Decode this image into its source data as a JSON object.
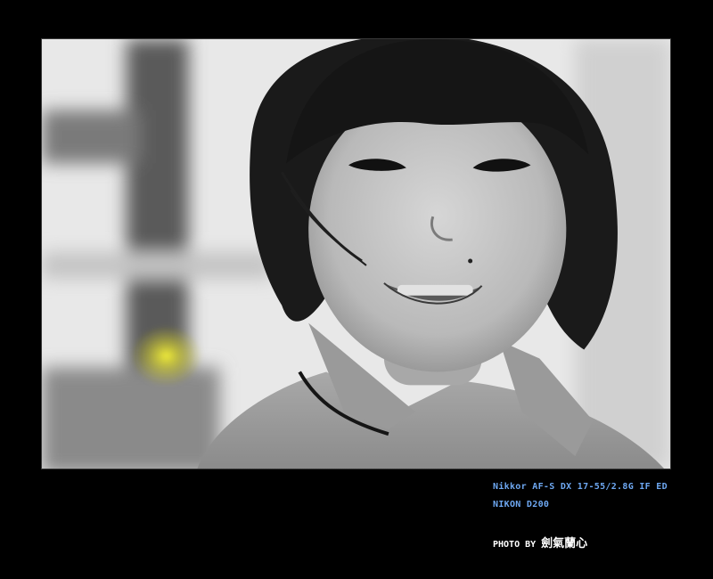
{
  "photo": {
    "subject": "smiling-girl-portrait",
    "colors": {
      "frame_background": "#000000",
      "caption_text": "#6ea8f2",
      "credit_text": "#ffffff",
      "accent_flower": "#e6e21e"
    }
  },
  "captions": {
    "lens": "Nikkor AF-S DX 17-55/2.8G IF ED",
    "camera": "NIKON D200"
  },
  "credit": {
    "label": "PHOTO BY",
    "name": "劍氣蘭心"
  }
}
